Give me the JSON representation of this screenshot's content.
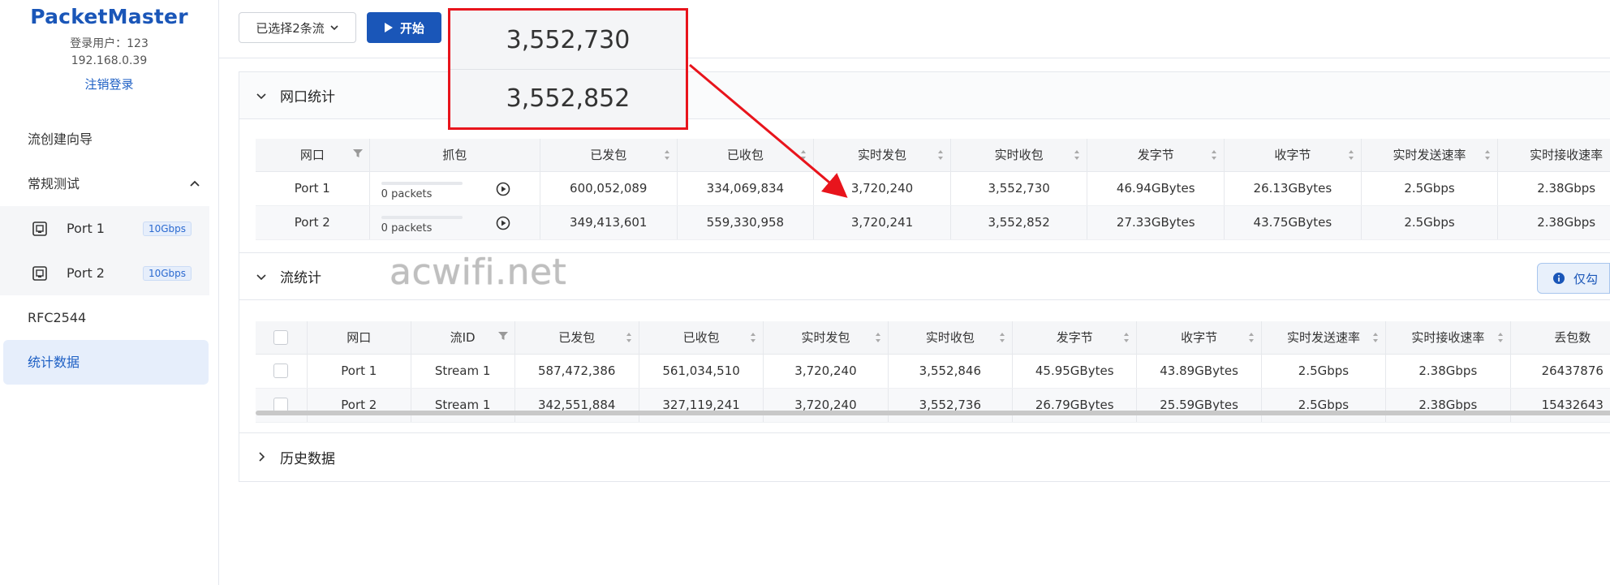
{
  "sidebar": {
    "brand": "PacketMaster",
    "user_line": "登录用户：123",
    "ip": "192.168.0.39",
    "logout": "注销登录",
    "items": [
      {
        "label": "流创建向导"
      },
      {
        "label": "常规测试"
      },
      {
        "label": "RFC2544"
      },
      {
        "label": "统计数据"
      }
    ],
    "ports": [
      {
        "label": "Port 1",
        "speed": "10Gbps"
      },
      {
        "label": "Port 2",
        "speed": "10Gbps"
      }
    ]
  },
  "toolbar": {
    "select_label": "已选择2条流",
    "start_label": "开始"
  },
  "zoom": {
    "value1": "3,552,730",
    "value2": "3,552,852"
  },
  "port_stats": {
    "title": "网口统计",
    "headers": [
      "网口",
      "抓包",
      "已发包",
      "已收包",
      "实时发包",
      "实时收包",
      "发字节",
      "收字节",
      "实时发送速率",
      "实时接收速率"
    ],
    "rows": [
      {
        "port": "Port 1",
        "capture": "0 packets",
        "sent": "600,052,089",
        "recv": "334,069,834",
        "rt_sent": "3,720,240",
        "rt_recv": "3,552,730",
        "tx_bytes": "46.94GBytes",
        "rx_bytes": "26.13GBytes",
        "tx_rate": "2.5Gbps",
        "rx_rate": "2.38Gbps"
      },
      {
        "port": "Port 2",
        "capture": "0 packets",
        "sent": "349,413,601",
        "recv": "559,330,958",
        "rt_sent": "3,720,241",
        "rt_recv": "3,552,852",
        "tx_bytes": "27.33GBytes",
        "rx_bytes": "43.75GBytes",
        "tx_rate": "2.5Gbps",
        "rx_rate": "2.38Gbps"
      }
    ]
  },
  "flow_stats": {
    "title": "流统计",
    "info_btn": "仅勾",
    "headers": [
      "网口",
      "流ID",
      "已发包",
      "已收包",
      "实时发包",
      "实时收包",
      "发字节",
      "收字节",
      "实时发送速率",
      "实时接收速率",
      "丢包数"
    ],
    "rows": [
      {
        "port": "Port 1",
        "stream": "Stream 1",
        "sent": "587,472,386",
        "recv": "561,034,510",
        "rt_sent": "3,720,240",
        "rt_recv": "3,552,846",
        "tx_bytes": "45.95GBytes",
        "rx_bytes": "43.89GBytes",
        "tx_rate": "2.5Gbps",
        "rx_rate": "2.38Gbps",
        "loss": "26437876"
      },
      {
        "port": "Port 2",
        "stream": "Stream 1",
        "sent": "342,551,884",
        "recv": "327,119,241",
        "rt_sent": "3,720,240",
        "rt_recv": "3,552,736",
        "tx_bytes": "26.79GBytes",
        "rx_bytes": "25.59GBytes",
        "tx_rate": "2.5Gbps",
        "rx_rate": "2.38Gbps",
        "loss": "15432643"
      }
    ]
  },
  "history": {
    "title": "历史数据"
  },
  "watermark": "acwifi.net",
  "colors": {
    "brand": "#1a56b8",
    "highlight": "#e8141c"
  }
}
